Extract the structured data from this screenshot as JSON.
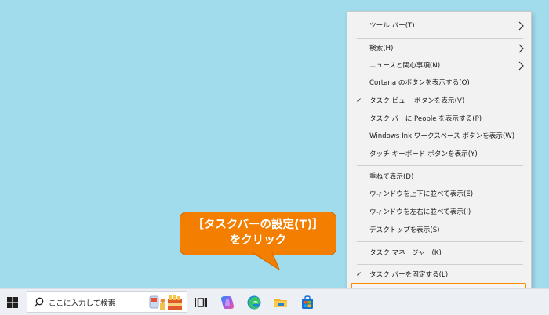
{
  "context_menu": {
    "items": [
      {
        "label": "ツール バー(T)",
        "submenu": true
      },
      {
        "label": "検索(H)",
        "submenu": true
      },
      {
        "label": "ニュースと関心事項(N)",
        "submenu": true
      },
      {
        "label": "Cortana のボタンを表示する(O)"
      },
      {
        "label": "タスク ビュー ボタンを表示(V)",
        "checked": true
      },
      {
        "label": "タスク バーに People を表示する(P)"
      },
      {
        "label": "Windows Ink ワークスペース ボタンを表示(W)"
      },
      {
        "label": "タッチ キーボード ボタンを表示(Y)"
      },
      {
        "label": "重ねて表示(D)"
      },
      {
        "label": "ウィンドウを上下に並べて表示(E)"
      },
      {
        "label": "ウィンドウを左右に並べて表示(I)"
      },
      {
        "label": "デスクトップを表示(S)"
      },
      {
        "label": "タスク マネージャー(K)"
      },
      {
        "label": "タスク バーを固定する(L)",
        "checked": true
      },
      {
        "label": "タスク バーの設定(T)",
        "icon": "gear-icon",
        "highlighted": true
      }
    ]
  },
  "callout": {
    "line1": "［タスクバーの設定(T)］",
    "line2": "をクリック",
    "color": "#f47e00"
  },
  "taskbar": {
    "search_placeholder": "ここに入力して検索",
    "icons": [
      "windows-start-icon",
      "search-icon",
      "task-view-icon",
      "copilot-icon",
      "edge-icon",
      "file-explorer-icon",
      "microsoft-store-icon"
    ]
  },
  "colors": {
    "desktop": "#a1dced",
    "highlight_border": "#ff8a00"
  }
}
